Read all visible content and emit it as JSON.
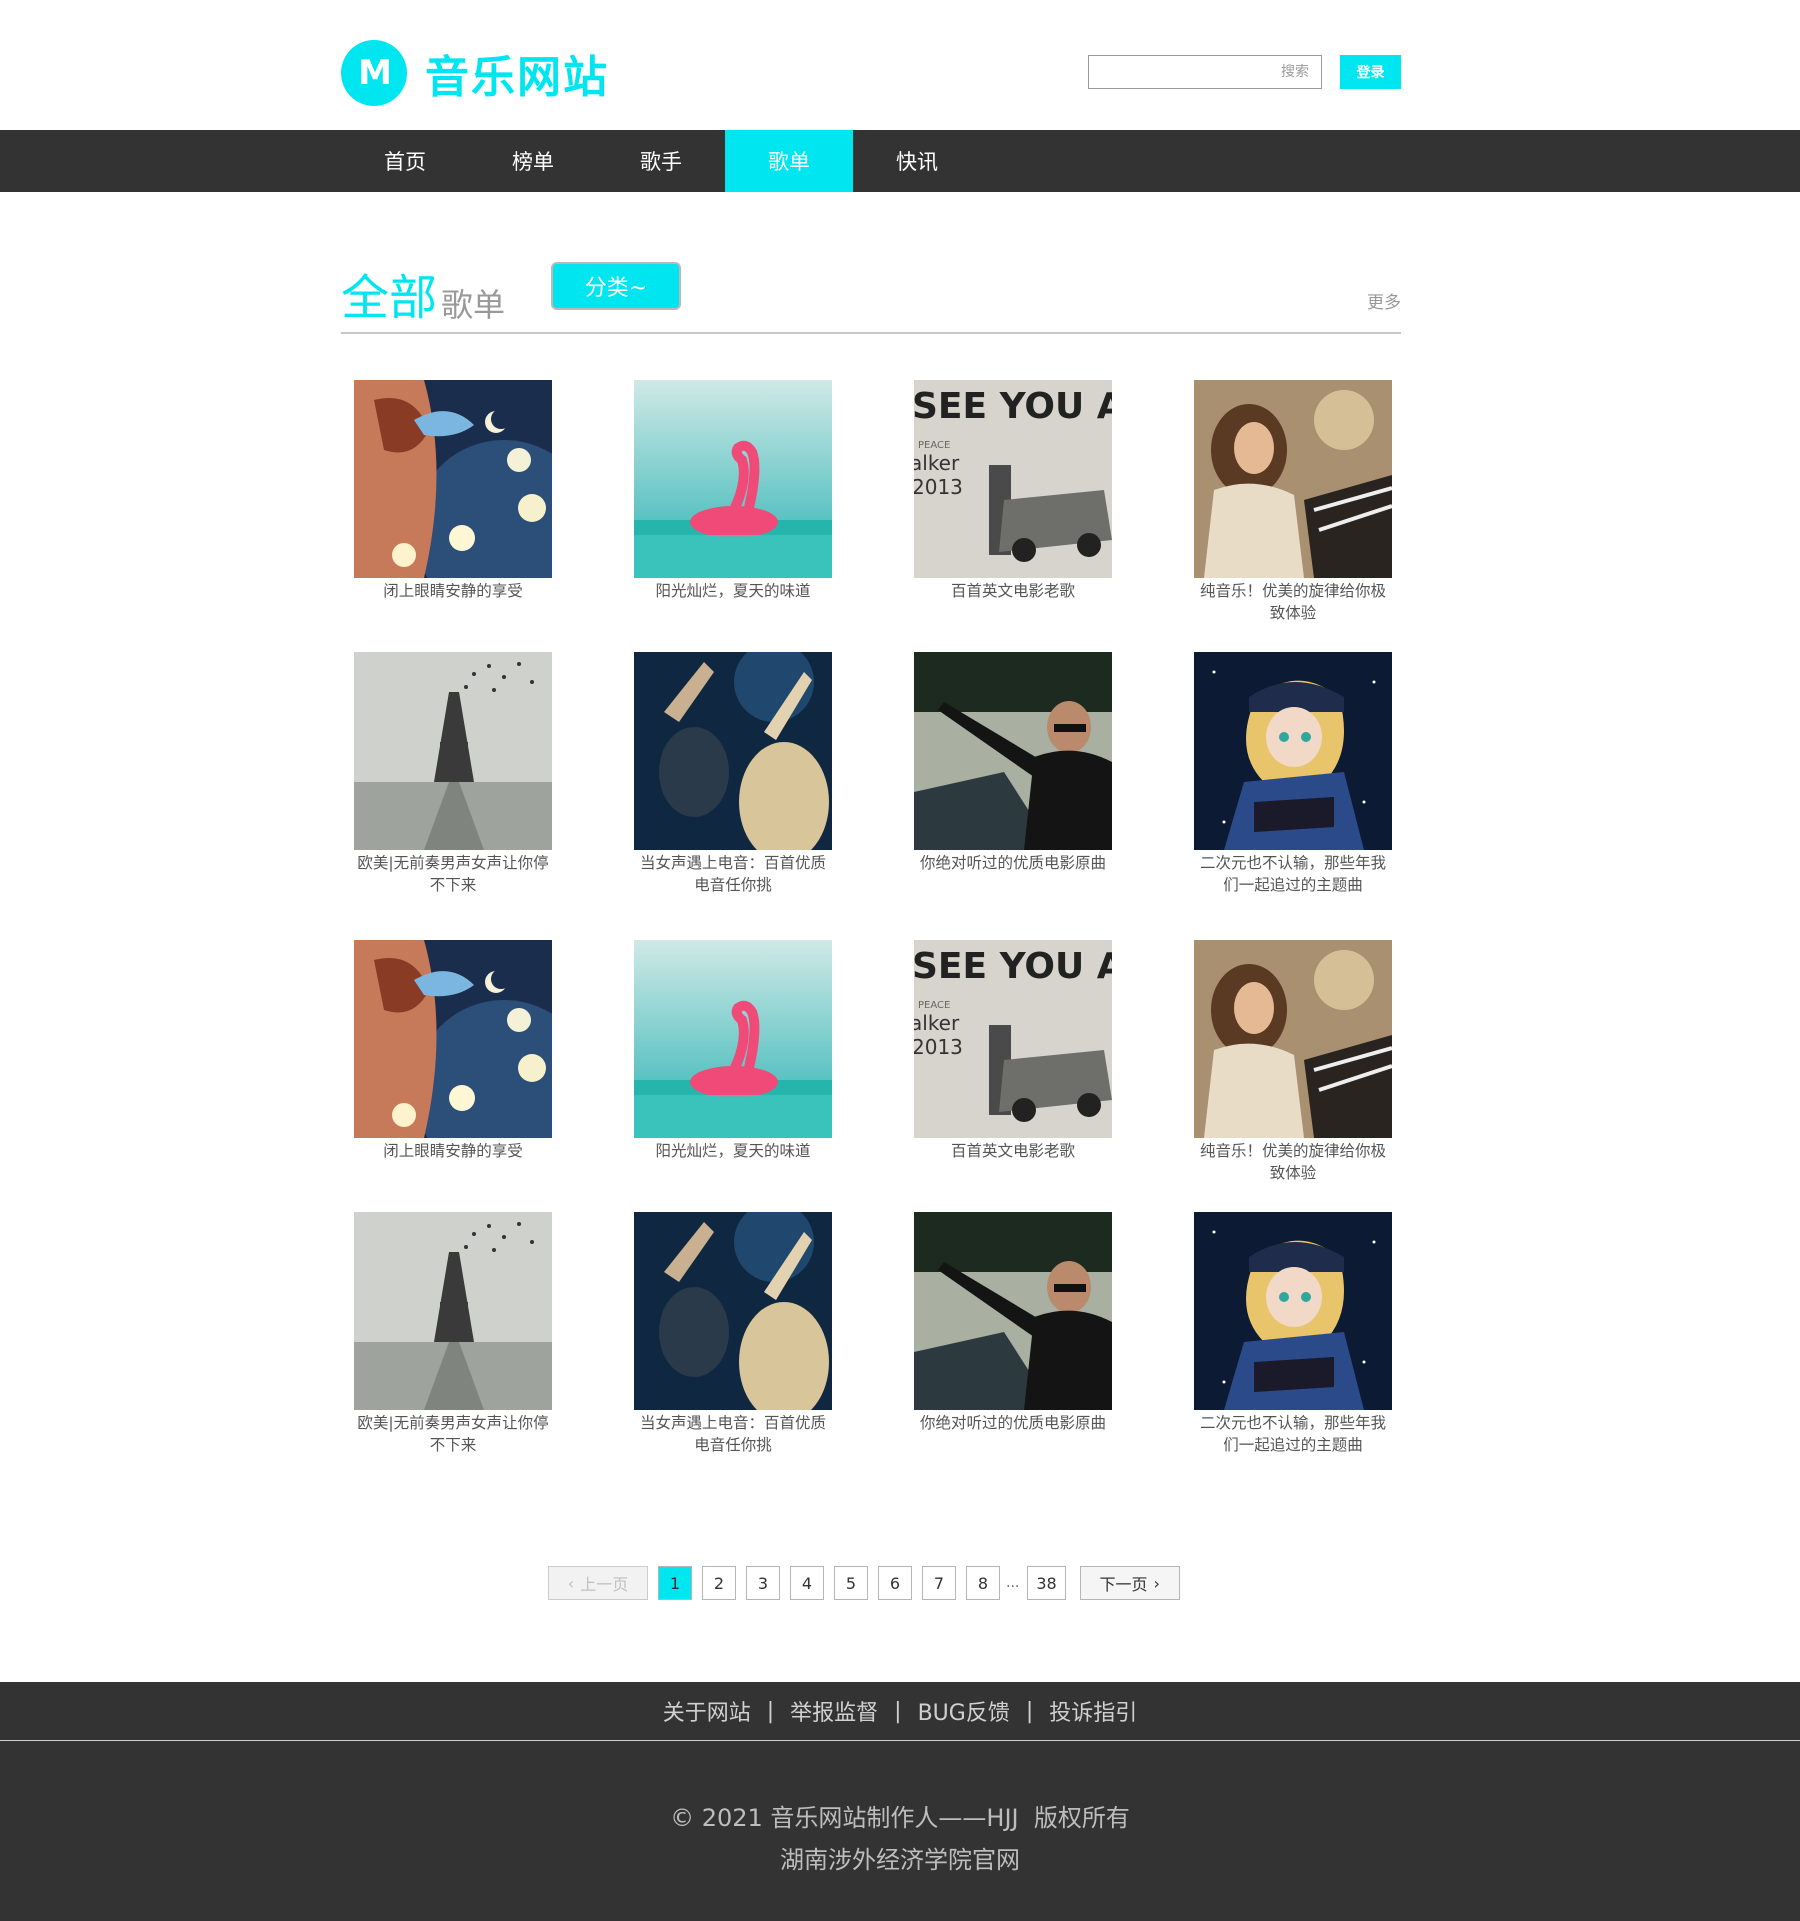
{
  "header": {
    "logo_mark": "M",
    "logo_text": "音乐网站",
    "search_placeholder": "搜索",
    "login_label": "登录"
  },
  "nav": {
    "items": [
      {
        "label": "首页"
      },
      {
        "label": "榜单"
      },
      {
        "label": "歌手"
      },
      {
        "label": "歌单",
        "active": true
      },
      {
        "label": "快讯"
      }
    ]
  },
  "section": {
    "title_big": "全部",
    "title_small": "歌单",
    "category_button": "分类~",
    "more_link": "更多"
  },
  "playlists": [
    {
      "title": "闭上眼睛安静的享受",
      "cover": "moon-bird"
    },
    {
      "title": "阳光灿烂，夏天的味道",
      "cover": "flamingo"
    },
    {
      "title": "百首英文电影老歌",
      "cover": "see-you-again"
    },
    {
      "title": "纯音乐！优美的旋律给你极致体验",
      "cover": "piano-girl"
    },
    {
      "title": "欧美|无前奏男声女声让你停不下来",
      "cover": "eiffel-tower"
    },
    {
      "title": "当女声遇上电音：百首优质电音任你挑",
      "cover": "concert"
    },
    {
      "title": "你绝对听过的优质电影原曲",
      "cover": "actor-pointing"
    },
    {
      "title": "二次元也不认输，那些年我们一起追过的主题曲",
      "cover": "anime-girl"
    },
    {
      "title": "闭上眼睛安静的享受",
      "cover": "moon-bird"
    },
    {
      "title": "阳光灿烂，夏天的味道",
      "cover": "flamingo"
    },
    {
      "title": "百首英文电影老歌",
      "cover": "see-you-again"
    },
    {
      "title": "纯音乐！优美的旋律给你极致体验",
      "cover": "piano-girl"
    },
    {
      "title": "欧美|无前奏男声女声让你停不下来",
      "cover": "eiffel-tower"
    },
    {
      "title": "当女声遇上电音：百首优质电音任你挑",
      "cover": "concert"
    },
    {
      "title": "你绝对听过的优质电影原曲",
      "cover": "actor-pointing"
    },
    {
      "title": "二次元也不认输，那些年我们一起追过的主题曲",
      "cover": "anime-girl"
    }
  ],
  "cover_text": {
    "see_you_again_title": "SEE YOU AGAIN",
    "see_you_again_sub1": "PEACE",
    "see_you_again_sub2": "alker",
    "see_you_again_year": "2013"
  },
  "pagination": {
    "prev": "上一页",
    "pages": [
      "1",
      "2",
      "3",
      "4",
      "5",
      "6",
      "7",
      "8"
    ],
    "ellipsis": "...",
    "last": "38",
    "next": "下一页",
    "current": "1"
  },
  "footer": {
    "links": [
      "关于网站",
      "举报监督",
      "BUG反馈",
      "投诉指引"
    ],
    "separator": "|",
    "copyright": "© 2021 音乐网站制作人——HJJ  版权所有",
    "school": "湖南涉外经济学院官网"
  },
  "colors": {
    "accent": "#00e6f0",
    "nav_bg": "#333333",
    "footer_bg": "#333333"
  }
}
